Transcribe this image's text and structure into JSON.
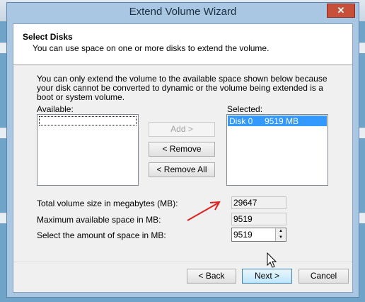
{
  "window": {
    "title": "Extend Volume Wizard",
    "close_glyph": "✕"
  },
  "header": {
    "title": "Select Disks",
    "subtitle": "You can use space on one or more disks to extend the volume."
  },
  "description": "You can only extend the volume to the available space shown below because your disk cannot be converted to dynamic or the volume being extended is a boot or system volume.",
  "available": {
    "label": "Available:",
    "items": []
  },
  "selected": {
    "label": "Selected:",
    "items": [
      {
        "disk": "Disk 0",
        "size": "9519 MB"
      }
    ]
  },
  "buttons": {
    "add": "Add >",
    "remove": "< Remove",
    "remove_all": "< Remove All"
  },
  "fields": {
    "total_label": "Total volume size in megabytes (MB):",
    "total_value": "29647",
    "max_label": "Maximum available space in MB:",
    "max_value": "9519",
    "amount_label": "Select the amount of space in MB:",
    "amount_value": "9519"
  },
  "footer": {
    "back": "< Back",
    "next": "Next >",
    "cancel": "Cancel"
  },
  "colors": {
    "selection": "#3399ff",
    "annotation_arrow": "#e02020",
    "frame": "#a9c7e3"
  },
  "icons": {
    "annotation": "red-arrow-icon",
    "cursor": "mouse-pointer-icon"
  }
}
